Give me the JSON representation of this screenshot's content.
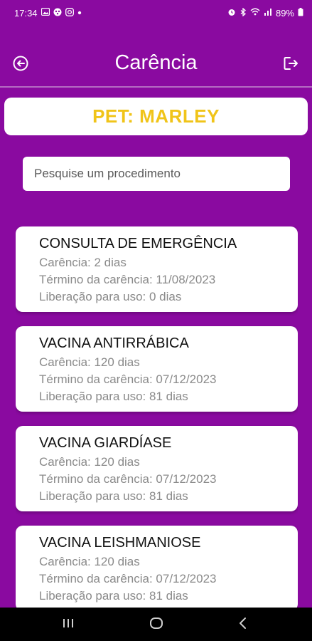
{
  "status_bar": {
    "time": "17:34",
    "notification_icons": [
      "image-icon",
      "game-icon",
      "instagram-icon",
      "dot-icon"
    ],
    "system_icons": [
      "alarm-icon",
      "bluetooth-icon",
      "wifi-icon",
      "signal-icon"
    ],
    "battery": "89%"
  },
  "header": {
    "title": "Carência",
    "back_icon": "back-arrow-icon",
    "logout_icon": "logout-icon"
  },
  "pet": {
    "label": "PET: MARLEY"
  },
  "search": {
    "placeholder": "Pesquise um procedimento",
    "value": ""
  },
  "procedures": [
    {
      "name": "CONSULTA DE EMERGÊNCIA",
      "carencia": "Carência: 2 dias",
      "termino": "Término da carência: 11/08/2023",
      "liberacao": "Liberação para uso: 0 dias"
    },
    {
      "name": "VACINA ANTIRRÁBICA",
      "carencia": "Carência: 120 dias",
      "termino": "Término da carência: 07/12/2023",
      "liberacao": "Liberação para uso: 81 dias"
    },
    {
      "name": "VACINA GIARDÍASE",
      "carencia": "Carência: 120 dias",
      "termino": "Término da carência: 07/12/2023",
      "liberacao": "Liberação para uso: 81 dias"
    },
    {
      "name": "VACINA LEISHMANIOSE",
      "carencia": "Carência: 120 dias",
      "termino": "Término da carência: 07/12/2023",
      "liberacao": "Liberação para uso: 81 dias"
    }
  ],
  "colors": {
    "background": "#8a0aa0",
    "pet_label": "#f0c419",
    "card": "#ffffff",
    "nav_bar": "#000000"
  },
  "nav_bar": {
    "icons": [
      "recents-icon",
      "home-icon",
      "back-icon"
    ]
  }
}
